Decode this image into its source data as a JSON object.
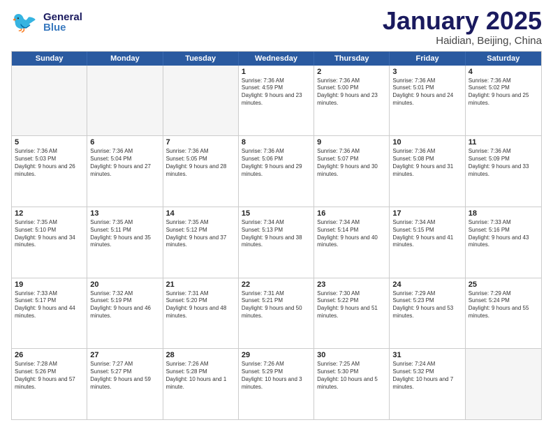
{
  "logo": {
    "general": "General",
    "blue": "Blue"
  },
  "title": "January 2025",
  "location": "Haidian, Beijing, China",
  "days_of_week": [
    "Sunday",
    "Monday",
    "Tuesday",
    "Wednesday",
    "Thursday",
    "Friday",
    "Saturday"
  ],
  "weeks": [
    [
      {
        "day": "",
        "text": ""
      },
      {
        "day": "",
        "text": ""
      },
      {
        "day": "",
        "text": ""
      },
      {
        "day": "1",
        "text": "Sunrise: 7:36 AM\nSunset: 4:59 PM\nDaylight: 9 hours and 23 minutes."
      },
      {
        "day": "2",
        "text": "Sunrise: 7:36 AM\nSunset: 5:00 PM\nDaylight: 9 hours and 23 minutes."
      },
      {
        "day": "3",
        "text": "Sunrise: 7:36 AM\nSunset: 5:01 PM\nDaylight: 9 hours and 24 minutes."
      },
      {
        "day": "4",
        "text": "Sunrise: 7:36 AM\nSunset: 5:02 PM\nDaylight: 9 hours and 25 minutes."
      }
    ],
    [
      {
        "day": "5",
        "text": "Sunrise: 7:36 AM\nSunset: 5:03 PM\nDaylight: 9 hours and 26 minutes."
      },
      {
        "day": "6",
        "text": "Sunrise: 7:36 AM\nSunset: 5:04 PM\nDaylight: 9 hours and 27 minutes."
      },
      {
        "day": "7",
        "text": "Sunrise: 7:36 AM\nSunset: 5:05 PM\nDaylight: 9 hours and 28 minutes."
      },
      {
        "day": "8",
        "text": "Sunrise: 7:36 AM\nSunset: 5:06 PM\nDaylight: 9 hours and 29 minutes."
      },
      {
        "day": "9",
        "text": "Sunrise: 7:36 AM\nSunset: 5:07 PM\nDaylight: 9 hours and 30 minutes."
      },
      {
        "day": "10",
        "text": "Sunrise: 7:36 AM\nSunset: 5:08 PM\nDaylight: 9 hours and 31 minutes."
      },
      {
        "day": "11",
        "text": "Sunrise: 7:36 AM\nSunset: 5:09 PM\nDaylight: 9 hours and 33 minutes."
      }
    ],
    [
      {
        "day": "12",
        "text": "Sunrise: 7:35 AM\nSunset: 5:10 PM\nDaylight: 9 hours and 34 minutes."
      },
      {
        "day": "13",
        "text": "Sunrise: 7:35 AM\nSunset: 5:11 PM\nDaylight: 9 hours and 35 minutes."
      },
      {
        "day": "14",
        "text": "Sunrise: 7:35 AM\nSunset: 5:12 PM\nDaylight: 9 hours and 37 minutes."
      },
      {
        "day": "15",
        "text": "Sunrise: 7:34 AM\nSunset: 5:13 PM\nDaylight: 9 hours and 38 minutes."
      },
      {
        "day": "16",
        "text": "Sunrise: 7:34 AM\nSunset: 5:14 PM\nDaylight: 9 hours and 40 minutes."
      },
      {
        "day": "17",
        "text": "Sunrise: 7:34 AM\nSunset: 5:15 PM\nDaylight: 9 hours and 41 minutes."
      },
      {
        "day": "18",
        "text": "Sunrise: 7:33 AM\nSunset: 5:16 PM\nDaylight: 9 hours and 43 minutes."
      }
    ],
    [
      {
        "day": "19",
        "text": "Sunrise: 7:33 AM\nSunset: 5:17 PM\nDaylight: 9 hours and 44 minutes."
      },
      {
        "day": "20",
        "text": "Sunrise: 7:32 AM\nSunset: 5:19 PM\nDaylight: 9 hours and 46 minutes."
      },
      {
        "day": "21",
        "text": "Sunrise: 7:31 AM\nSunset: 5:20 PM\nDaylight: 9 hours and 48 minutes."
      },
      {
        "day": "22",
        "text": "Sunrise: 7:31 AM\nSunset: 5:21 PM\nDaylight: 9 hours and 50 minutes."
      },
      {
        "day": "23",
        "text": "Sunrise: 7:30 AM\nSunset: 5:22 PM\nDaylight: 9 hours and 51 minutes."
      },
      {
        "day": "24",
        "text": "Sunrise: 7:29 AM\nSunset: 5:23 PM\nDaylight: 9 hours and 53 minutes."
      },
      {
        "day": "25",
        "text": "Sunrise: 7:29 AM\nSunset: 5:24 PM\nDaylight: 9 hours and 55 minutes."
      }
    ],
    [
      {
        "day": "26",
        "text": "Sunrise: 7:28 AM\nSunset: 5:26 PM\nDaylight: 9 hours and 57 minutes."
      },
      {
        "day": "27",
        "text": "Sunrise: 7:27 AM\nSunset: 5:27 PM\nDaylight: 9 hours and 59 minutes."
      },
      {
        "day": "28",
        "text": "Sunrise: 7:26 AM\nSunset: 5:28 PM\nDaylight: 10 hours and 1 minute."
      },
      {
        "day": "29",
        "text": "Sunrise: 7:26 AM\nSunset: 5:29 PM\nDaylight: 10 hours and 3 minutes."
      },
      {
        "day": "30",
        "text": "Sunrise: 7:25 AM\nSunset: 5:30 PM\nDaylight: 10 hours and 5 minutes."
      },
      {
        "day": "31",
        "text": "Sunrise: 7:24 AM\nSunset: 5:32 PM\nDaylight: 10 hours and 7 minutes."
      },
      {
        "day": "",
        "text": ""
      }
    ]
  ]
}
